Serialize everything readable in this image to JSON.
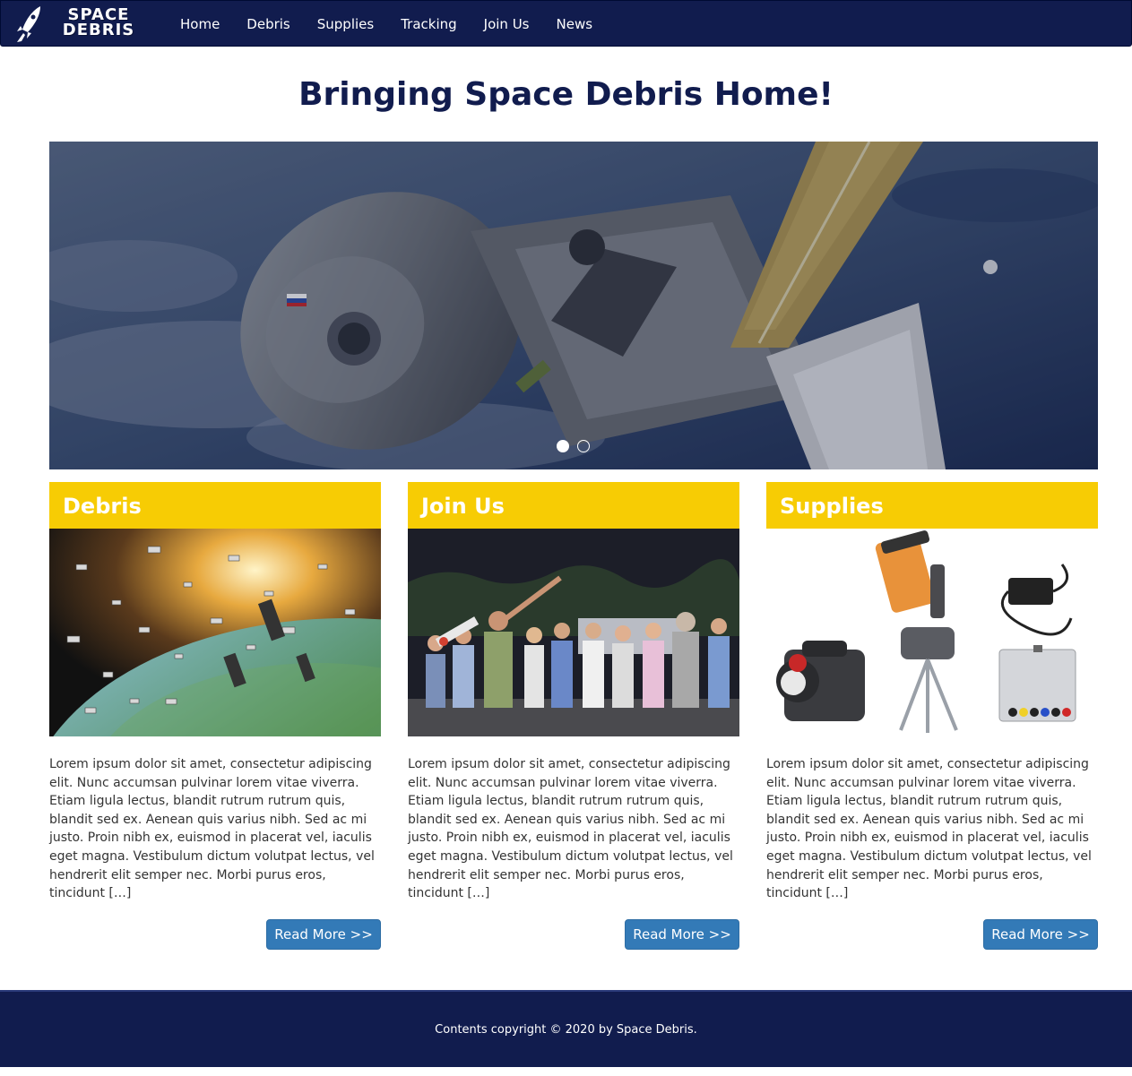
{
  "brand": {
    "logo_line1": "SPACE",
    "logo_line2": "DEBRIS",
    "colors": {
      "navy": "#111c4e",
      "yellow": "#f7cc04",
      "button_blue": "#337ab7"
    }
  },
  "nav": {
    "items": [
      {
        "label": "Home"
      },
      {
        "label": "Debris"
      },
      {
        "label": "Supplies"
      },
      {
        "label": "Tracking"
      },
      {
        "label": "Join Us"
      },
      {
        "label": "News"
      }
    ]
  },
  "main": {
    "title": "Bringing Space Debris Home!",
    "carousel": {
      "slide_count": 2,
      "active_slide": 1
    },
    "cards": [
      {
        "title": "Debris",
        "image": "space-debris-orbit-image",
        "text": "Lorem ipsum dolor sit amet, consectetur adipiscing elit. Nunc accumsan pulvinar lorem vitae viverra. Etiam ligula lectus, blandit rutrum rutrum quis, blandit sed ex. Aenean quis varius nibh. Sed ac mi justo. Proin nibh ex, euismod in placerat vel, iaculis eget magna. Vestibulum dictum volutpat lectus, vel hendrerit elit semper nec. Morbi purus eros, tincidunt […]",
        "button": "Read More >>"
      },
      {
        "title": "Join Us",
        "image": "stargazing-group-image",
        "text": "Lorem ipsum dolor sit amet, consectetur adipiscing elit. Nunc accumsan pulvinar lorem vitae viverra. Etiam ligula lectus, blandit rutrum rutrum quis, blandit sed ex. Aenean quis varius nibh. Sed ac mi justo. Proin nibh ex, euismod in placerat vel, iaculis eget magna. Vestibulum dictum volutpat lectus, vel hendrerit elit semper nec. Morbi purus eros, tincidunt […]",
        "button": "Read More >>"
      },
      {
        "title": "Supplies",
        "image": "telescope-supplies-image",
        "text": "Lorem ipsum dolor sit amet, consectetur adipiscing elit. Nunc accumsan pulvinar lorem vitae viverra. Etiam ligula lectus, blandit rutrum rutrum quis, blandit sed ex. Aenean quis varius nibh. Sed ac mi justo. Proin nibh ex, euismod in placerat vel, iaculis eget magna. Vestibulum dictum volutpat lectus, vel hendrerit elit semper nec. Morbi purus eros, tincidunt […]",
        "button": "Read More >>"
      }
    ]
  },
  "footer": {
    "copyright": "Contents copyright © 2020 by Space Debris."
  }
}
